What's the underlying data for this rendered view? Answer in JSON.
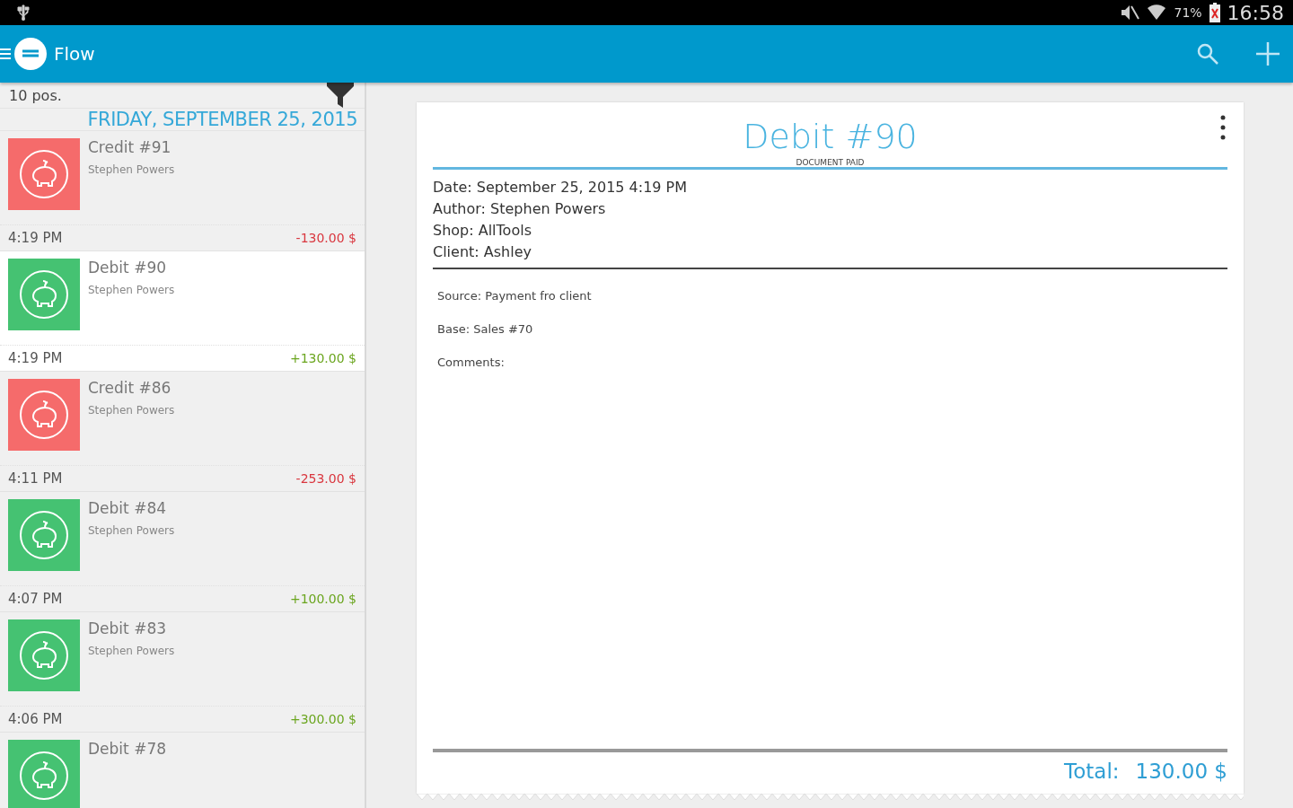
{
  "status_bar": {
    "battery": "71%",
    "time": "16:58"
  },
  "app_bar": {
    "title": "Flow"
  },
  "list": {
    "count": "10 pos.",
    "date_header": "FRIDAY, SEPTEMBER 25, 2015",
    "items": [
      {
        "kind": "credit",
        "title": "Credit #91",
        "author": "Stephen Powers",
        "time": "4:19 PM",
        "amount": "-130.00 $",
        "selected": false
      },
      {
        "kind": "debit",
        "title": "Debit #90",
        "author": "Stephen Powers",
        "time": "4:19 PM",
        "amount": "+130.00 $",
        "selected": true
      },
      {
        "kind": "credit",
        "title": "Credit #86",
        "author": "Stephen Powers",
        "time": "4:11 PM",
        "amount": "-253.00 $",
        "selected": false
      },
      {
        "kind": "debit",
        "title": "Debit #84",
        "author": "Stephen Powers",
        "time": "4:07 PM",
        "amount": "+100.00 $",
        "selected": false
      },
      {
        "kind": "debit",
        "title": "Debit #83",
        "author": "Stephen Powers",
        "time": "4:06 PM",
        "amount": "+300.00 $",
        "selected": false
      },
      {
        "kind": "debit",
        "title": "Debit #78",
        "selected": false
      }
    ]
  },
  "document": {
    "title": "Debit #90",
    "status": "DOCUMENT PAID",
    "info": [
      "Date: September 25, 2015 4:19 PM",
      "Author: Stephen Powers",
      "Shop: AllTools",
      "Client: Ashley"
    ],
    "details": [
      "Source: Payment fro client",
      "Base: Sales #70",
      "Comments:"
    ],
    "total_label": "Total:",
    "total_value": "130.00 $"
  }
}
